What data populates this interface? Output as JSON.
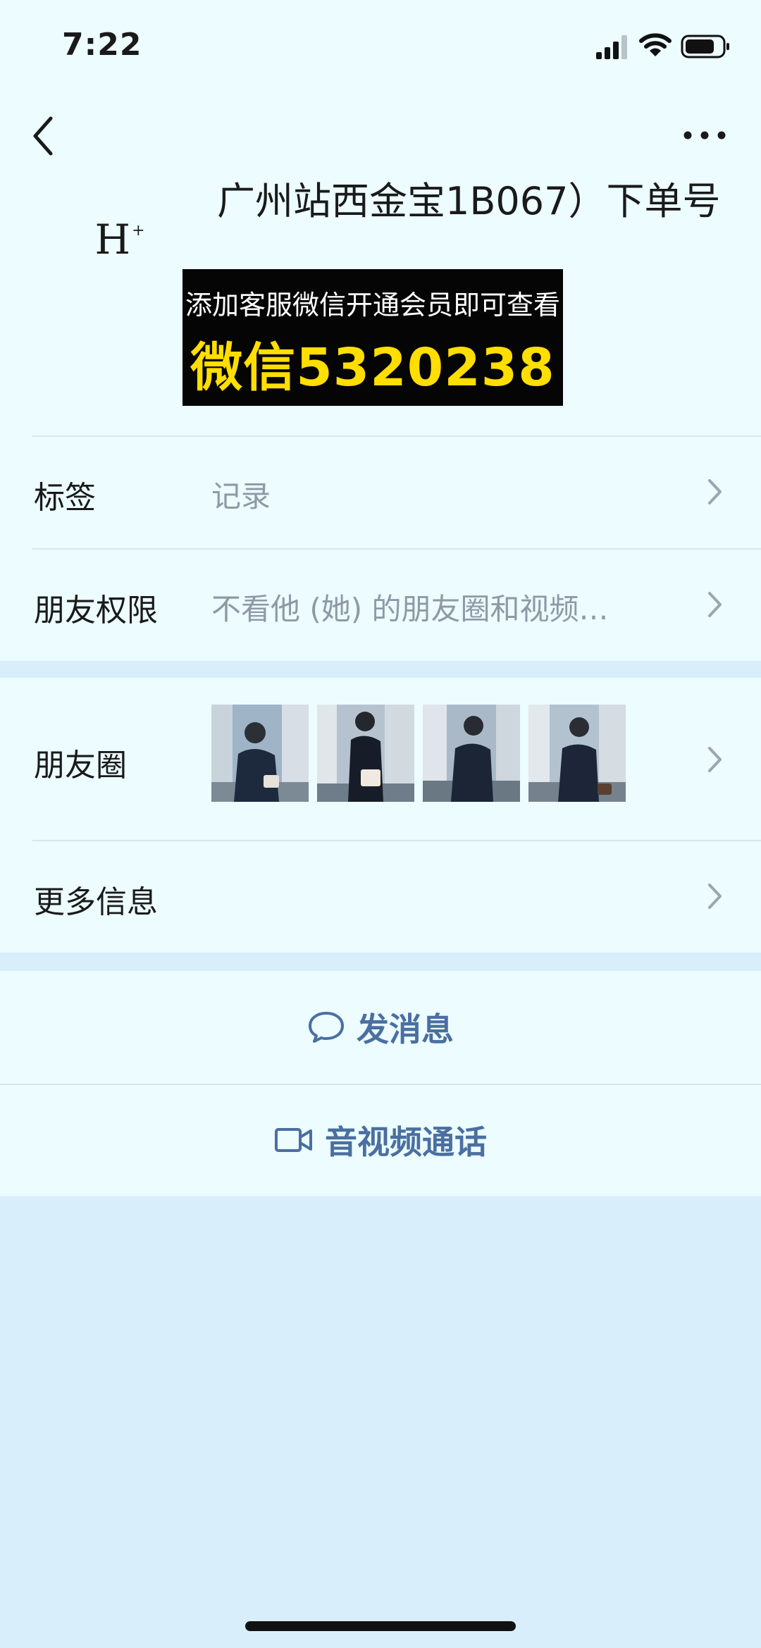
{
  "status_bar": {
    "time": "7:22"
  },
  "profile": {
    "avatar_text": "H",
    "avatar_sup": "+",
    "name": "广州站西金宝1B067）下单号"
  },
  "promo": {
    "line1": "添加客服微信开通会员即可查看",
    "line2": "微信5320238"
  },
  "rows": {
    "tags": {
      "label": "标签",
      "value": "记录"
    },
    "permissions": {
      "label": "朋友权限",
      "value": "不看他 (她) 的朋友圈和视频…"
    },
    "moments": {
      "label": "朋友圈"
    },
    "more_info": {
      "label": "更多信息"
    }
  },
  "actions": {
    "message": "发消息",
    "call": "音视频通话"
  },
  "colors": {
    "page_bg": "#ecfcff",
    "outer_bg": "#d8eefa",
    "accent": "#4a6fa0",
    "promo_yellow": "#ffde00"
  }
}
